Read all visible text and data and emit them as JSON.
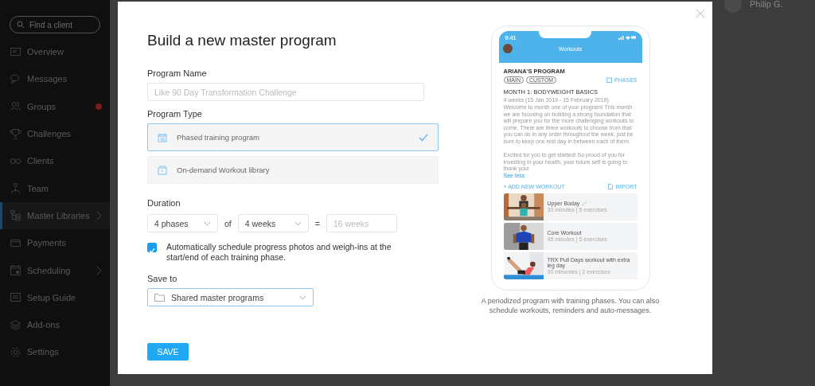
{
  "sidebar": {
    "search": {
      "placeholder": "Find a client"
    },
    "items": [
      {
        "label": "Overview",
        "selected": false,
        "notification": false,
        "submenu": false
      },
      {
        "label": "Messages",
        "selected": false,
        "notification": false,
        "submenu": false
      },
      {
        "label": "Groups",
        "selected": false,
        "notification": true,
        "submenu": false
      },
      {
        "label": "Challenges",
        "selected": false,
        "notification": false,
        "submenu": false
      },
      {
        "label": "Clients",
        "selected": false,
        "notification": false,
        "submenu": false
      },
      {
        "label": "Team",
        "selected": false,
        "notification": false,
        "submenu": false
      },
      {
        "label": "Master Libraries",
        "selected": true,
        "notification": false,
        "submenu": true
      },
      {
        "label": "Payments",
        "selected": false,
        "notification": false,
        "submenu": false
      },
      {
        "label": "Scheduling",
        "selected": false,
        "notification": false,
        "submenu": true
      },
      {
        "label": "Setup Guide",
        "selected": false,
        "notification": false,
        "submenu": false
      },
      {
        "label": "Add-ons",
        "selected": false,
        "notification": false,
        "submenu": false
      },
      {
        "label": "Settings",
        "selected": false,
        "notification": false,
        "submenu": false
      }
    ]
  },
  "header": {
    "user_name": "Philip G."
  },
  "modal": {
    "title": "Build a new master program",
    "program_name": {
      "label": "Program Name",
      "placeholder": "Like 90 Day Transformation Challenge"
    },
    "program_type": {
      "label": "Program Type",
      "options": [
        {
          "label": "Phased training program",
          "selected": true
        },
        {
          "label": "On-demand Workout library",
          "selected": false
        }
      ]
    },
    "duration": {
      "label": "Duration",
      "phases": "4 phases",
      "connector": "of",
      "weeks": "4 weeks",
      "equals": "=",
      "total": {
        "value": "16 weeks",
        "disabled": true
      }
    },
    "auto_schedule": {
      "label": "Automatically schedule progress photos and weigh-ins at the start/end of each training phase.",
      "checked": true
    },
    "save_to": {
      "label": "Save to",
      "value": "Shared master programs"
    },
    "save_button": "SAVE",
    "preview": {
      "time": "9:41",
      "screen_title": "Workouts",
      "program_title": "ARIANA'S PROGRAM",
      "tags": [
        "MAIN",
        "CUSTOM"
      ],
      "phases_link": "PHASES",
      "month_title": "MONTH 1: BODYWEIGHT BASICS",
      "dates": "4 weeks (15 Jan 2019 - 15 February 2019)",
      "description": [
        "Welcome to month one of your program! This month we are focusing on building a strong foundation that will prepare you for the more challenging workouts to come. There are three workouts to choose from that you can do in any order throughout the week, just be sure to keep one rest day in between each of them.",
        "Excited for you to get started! So proud of you for investing in your health, your future self is going to thank you!"
      ],
      "see_less": "See less",
      "add_workout": "+ ADD NEW WORKOUT",
      "import": "IMPORT",
      "workouts": [
        {
          "title": "Upper Boday",
          "meta": "30 minutes | 5 exercises",
          "linked": true
        },
        {
          "title": "Core Workout",
          "meta": "45 minutes | 5 exercises",
          "linked": false
        },
        {
          "title": "TRX Pull Days workout with extra leg day",
          "meta": "30 minuntes | 2 exercises",
          "linked": false
        }
      ],
      "caption": "A periodized program with training phases. You can also schedule workouts, reminders and auto-messages."
    }
  }
}
